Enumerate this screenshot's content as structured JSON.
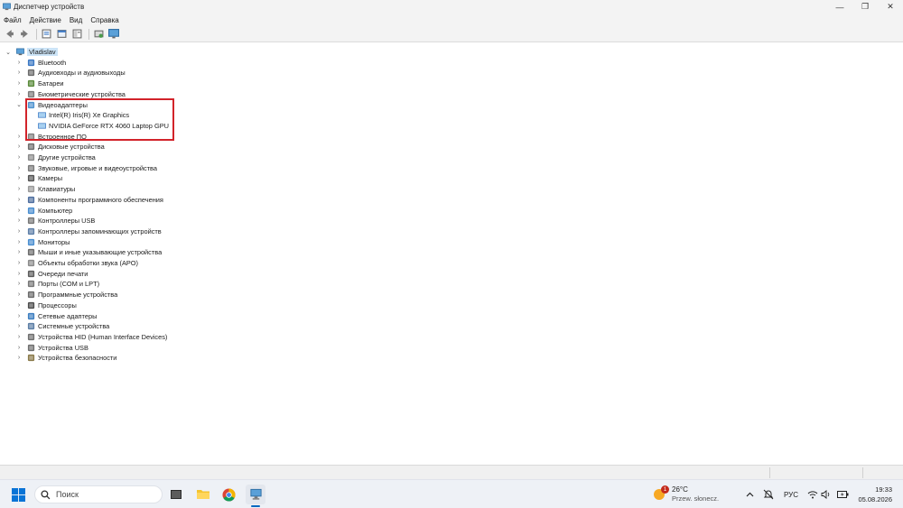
{
  "window": {
    "title": "Диспетчер устройств",
    "controls": {
      "minimize": "—",
      "maximize": "❐",
      "close": "✕"
    }
  },
  "menu": [
    "Файл",
    "Действие",
    "Вид",
    "Справка"
  ],
  "toolbar": {
    "buttons": [
      "back-icon",
      "forward-icon",
      "properties-icon",
      "show-hidden-icon",
      "help-icon",
      "scan-hardware-icon",
      "monitor-icon"
    ]
  },
  "tree": {
    "root": "Vladislav",
    "categories": [
      {
        "label": "Bluetooth",
        "expanded": false,
        "icon": "bluetooth-icon"
      },
      {
        "label": "Аудиовходы и аудиовыходы",
        "expanded": false,
        "icon": "speaker-icon"
      },
      {
        "label": "Батареи",
        "expanded": false,
        "icon": "battery-icon"
      },
      {
        "label": "Биометрические устройства",
        "expanded": false,
        "icon": "biometric-icon"
      },
      {
        "label": "Видеоадаптеры",
        "expanded": true,
        "icon": "display-adapter-icon",
        "children": [
          "Intel(R) Iris(R) Xe Graphics",
          "NVIDIA GeForce RTX 4060 Laptop GPU"
        ]
      },
      {
        "label": "Встроенное ПО",
        "expanded": false,
        "icon": "firmware-icon"
      },
      {
        "label": "Дисковые устройства",
        "expanded": false,
        "icon": "disk-icon"
      },
      {
        "label": "Другие устройства",
        "expanded": false,
        "icon": "other-device-icon"
      },
      {
        "label": "Звуковые, игровые и видеоустройства",
        "expanded": false,
        "icon": "sound-icon"
      },
      {
        "label": "Камеры",
        "expanded": false,
        "icon": "camera-icon"
      },
      {
        "label": "Клавиатуры",
        "expanded": false,
        "icon": "keyboard-icon"
      },
      {
        "label": "Компоненты программного обеспечения",
        "expanded": false,
        "icon": "software-component-icon"
      },
      {
        "label": "Компьютер",
        "expanded": false,
        "icon": "computer-icon"
      },
      {
        "label": "Контроллеры USB",
        "expanded": false,
        "icon": "usb-icon"
      },
      {
        "label": "Контроллеры запоминающих устройств",
        "expanded": false,
        "icon": "storage-controller-icon"
      },
      {
        "label": "Мониторы",
        "expanded": false,
        "icon": "monitor-icon"
      },
      {
        "label": "Мыши и иные указывающие устройства",
        "expanded": false,
        "icon": "mouse-icon"
      },
      {
        "label": "Объекты обработки звука (APO)",
        "expanded": false,
        "icon": "audio-processing-icon"
      },
      {
        "label": "Очереди печати",
        "expanded": false,
        "icon": "printer-icon"
      },
      {
        "label": "Порты (COM и LPT)",
        "expanded": false,
        "icon": "port-icon"
      },
      {
        "label": "Программные устройства",
        "expanded": false,
        "icon": "software-device-icon"
      },
      {
        "label": "Процессоры",
        "expanded": false,
        "icon": "processor-icon"
      },
      {
        "label": "Сетевые адаптеры",
        "expanded": false,
        "icon": "network-adapter-icon"
      },
      {
        "label": "Системные устройства",
        "expanded": false,
        "icon": "system-device-icon"
      },
      {
        "label": "Устройства HID (Human Interface Devices)",
        "expanded": false,
        "icon": "hid-icon"
      },
      {
        "label": "Устройства USB",
        "expanded": false,
        "icon": "usb-device-icon"
      },
      {
        "label": "Устройства безопасности",
        "expanded": false,
        "icon": "security-device-icon"
      }
    ]
  },
  "taskbar": {
    "search_placeholder": "Поиск",
    "weather": {
      "temp": "26°C",
      "desc": "Przew. słonecz.",
      "badge": "1"
    },
    "language": "РУС",
    "time": "19:33",
    "date": "05.08.2026"
  },
  "colors": {
    "highlight_box": "#d2232a",
    "selected_root": "#cce4f7",
    "accent": "#0067c0"
  }
}
